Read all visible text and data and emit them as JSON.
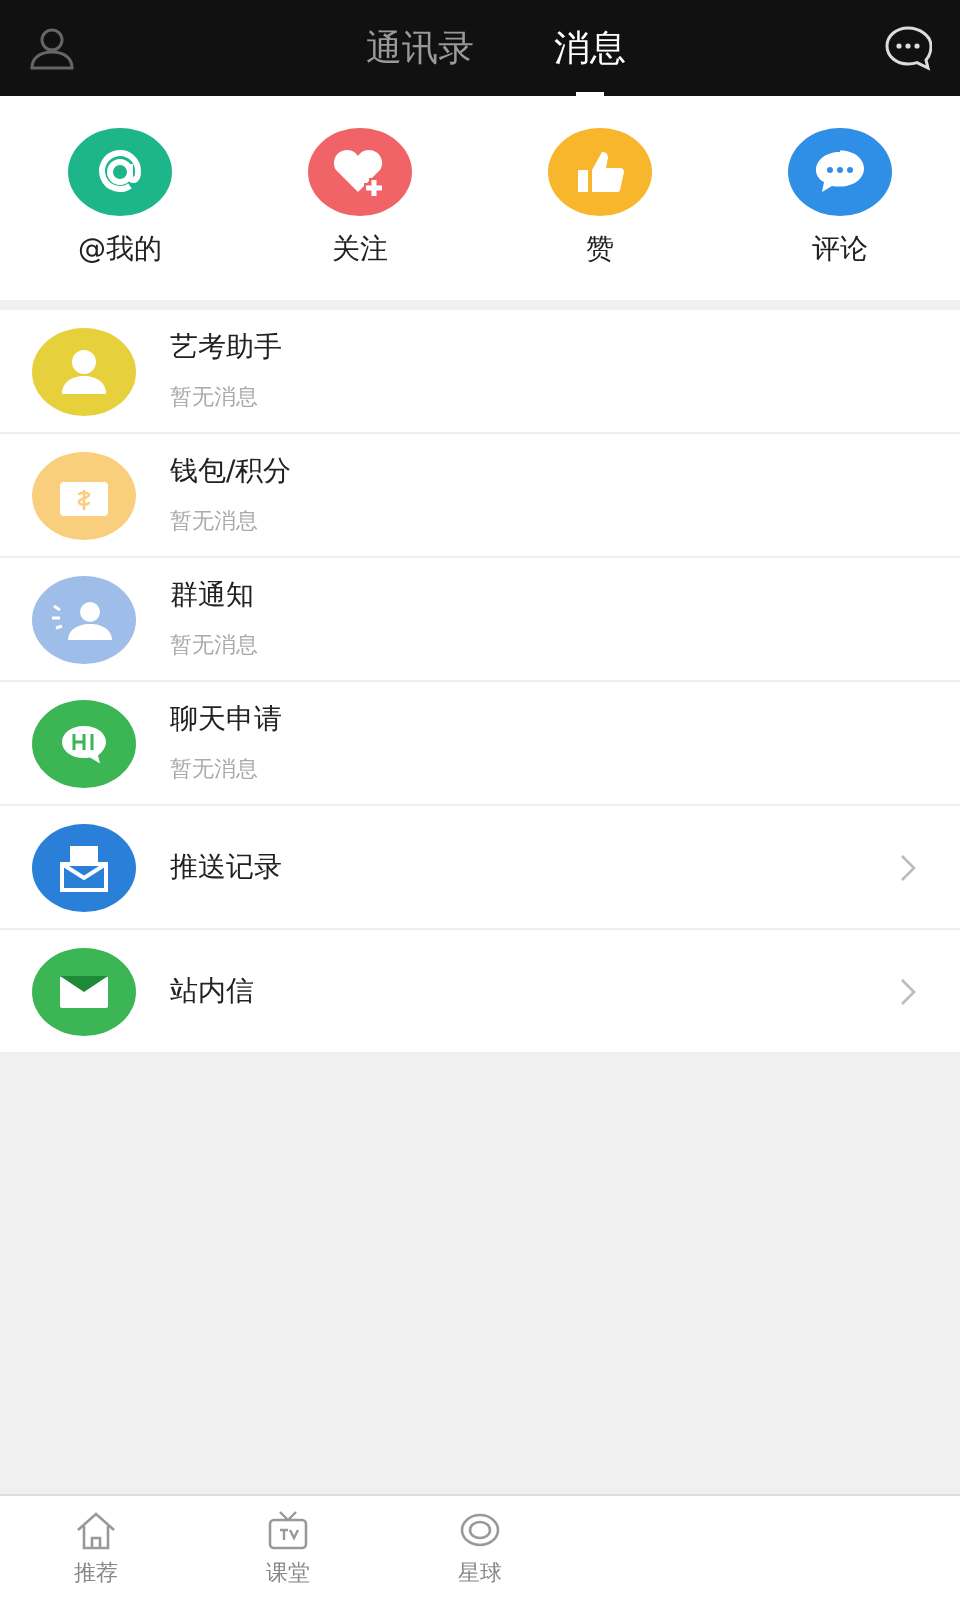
{
  "header": {
    "tabs": [
      {
        "label": "通讯录",
        "selected": false
      },
      {
        "label": "消息",
        "selected": true
      }
    ]
  },
  "shortcuts": [
    {
      "label": "@我的",
      "color": "#1db68a"
    },
    {
      "label": "关注",
      "color": "#f06467"
    },
    {
      "label": "赞",
      "color": "#f8b62c"
    },
    {
      "label": "评论",
      "color": "#2f8fe6"
    }
  ],
  "list": [
    {
      "kind": "message",
      "title": "艺考助手",
      "subtitle": "暂无消息",
      "color": "#e6d13c"
    },
    {
      "kind": "message",
      "title": "钱包/积分",
      "subtitle": "暂无消息",
      "color": "#f9cf7d"
    },
    {
      "kind": "message",
      "title": "群通知",
      "subtitle": "暂无消息",
      "color": "#9ebde9"
    },
    {
      "kind": "message",
      "title": "聊天申请",
      "subtitle": "暂无消息",
      "color": "#3cb554"
    },
    {
      "kind": "link",
      "title": "推送记录",
      "color": "#2a7fd9"
    },
    {
      "kind": "link",
      "title": "站内信",
      "color": "#3cb554"
    }
  ],
  "bottom_nav": [
    {
      "label": "推荐"
    },
    {
      "label": "课堂"
    },
    {
      "label": "星球"
    }
  ]
}
